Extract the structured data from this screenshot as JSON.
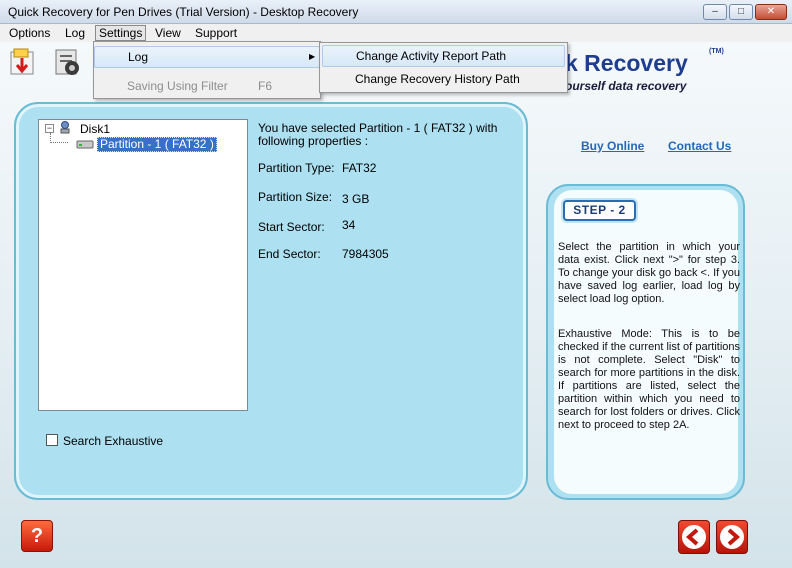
{
  "window": {
    "title": "Quick Recovery for Pen Drives (Trial Version) - Desktop Recovery",
    "minimize_glyph": "–",
    "maximize_glyph": "□",
    "close_glyph": "✕"
  },
  "menubar": {
    "items": [
      {
        "label": "Options"
      },
      {
        "label": "Log"
      },
      {
        "label": "Settings"
      },
      {
        "label": "View"
      },
      {
        "label": "Support"
      }
    ]
  },
  "settings_menu": {
    "items": [
      {
        "label": "Log",
        "has_submenu": true
      },
      {
        "label": "Saving Using Filter",
        "shortcut": "F6",
        "disabled": true
      }
    ],
    "log_submenu": [
      {
        "label": "Change Activity Report Path"
      },
      {
        "label": "Change Recovery History Path"
      }
    ]
  },
  "logo": {
    "title": "k Recovery",
    "tm": "(TM)",
    "subtitle": "ourself data recovery"
  },
  "tree": {
    "root": "Disk1",
    "expander": "−",
    "selected": "Partition - 1 ( FAT32 )"
  },
  "info": {
    "intro": "You have selected Partition - 1 ( FAT32 ) with following properties :",
    "properties": [
      {
        "label": "Partition Type:",
        "value": "FAT32"
      },
      {
        "label": "Partition Size:",
        "value": "3 GB"
      },
      {
        "label": "Start Sector:",
        "value": "34"
      },
      {
        "label": "End Sector:",
        "value": "7984305"
      }
    ]
  },
  "search_exhaustive": {
    "label": "Search Exhaustive",
    "checked": false
  },
  "links": {
    "buy": "Buy Online",
    "contact": "Contact Us"
  },
  "help_panel": {
    "step": "STEP - 2",
    "paragraph1": "Select the partition in which your data exist.  Click next \">\" for step 3. To change your disk  go  back <.  If  you have saved log earlier,   load  log  by select load log option.",
    "paragraph2": "Exhaustive Mode: This is to be checked if the current list of  partitions is not complete.  Select  \"Disk\"  to search for more partitions in the disk. If partitions are listed, select the  partition within which you need to search for lost folders or drives.  Click next to proceed to step 2A."
  },
  "buttons": {
    "help": "?"
  },
  "colors": {
    "panel": "#ade0f1",
    "panel_border": "#6bbbd6",
    "link": "#2667b8",
    "brand": "#1e3d8f",
    "selection": "#3571c6",
    "nav_red": "#d4200f"
  }
}
